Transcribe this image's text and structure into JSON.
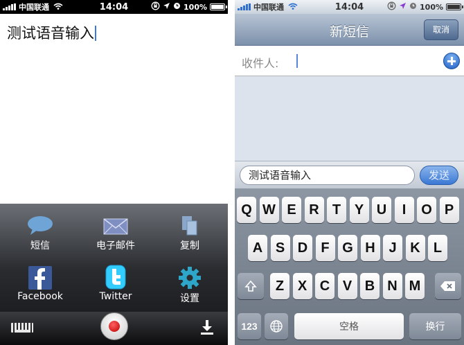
{
  "left_phone": {
    "status": {
      "carrier": "中国联通",
      "time": "14:04",
      "battery": "100%"
    },
    "note_text": "测试语音输入",
    "share_items": [
      {
        "label": "短信",
        "icon": "speech-bubble-icon"
      },
      {
        "label": "电子邮件",
        "icon": "envelope-icon"
      },
      {
        "label": "复制",
        "icon": "copy-icon"
      },
      {
        "label": "Facebook",
        "icon": "facebook-icon"
      },
      {
        "label": "Twitter",
        "icon": "twitter-icon"
      },
      {
        "label": "设置",
        "icon": "gear-icon"
      }
    ],
    "bottom": {
      "keyboard_icon": "keyboard-icon",
      "record_icon": "record-icon",
      "download_icon": "download-icon"
    }
  },
  "right_phone": {
    "status": {
      "carrier": "中国联通",
      "time": "14:04",
      "battery": "100%"
    },
    "nav": {
      "title": "新短信",
      "cancel": "取消"
    },
    "to_label": "收件人:",
    "compose_text": "测试语音输入",
    "send_label": "发送",
    "keyboard": {
      "row1": [
        "Q",
        "W",
        "E",
        "R",
        "T",
        "Y",
        "U",
        "I",
        "O",
        "P"
      ],
      "row2": [
        "A",
        "S",
        "D",
        "F",
        "G",
        "H",
        "J",
        "K",
        "L"
      ],
      "row3": [
        "Z",
        "X",
        "C",
        "V",
        "B",
        "N",
        "M"
      ],
      "num_key": "123",
      "space_key": "空格",
      "return_key": "换行"
    }
  },
  "colors": {
    "accent_blue": "#3a78d4",
    "record_red": "#c00000",
    "facebook_blue": "#3b5998",
    "twitter_blue": "#33ccff"
  }
}
